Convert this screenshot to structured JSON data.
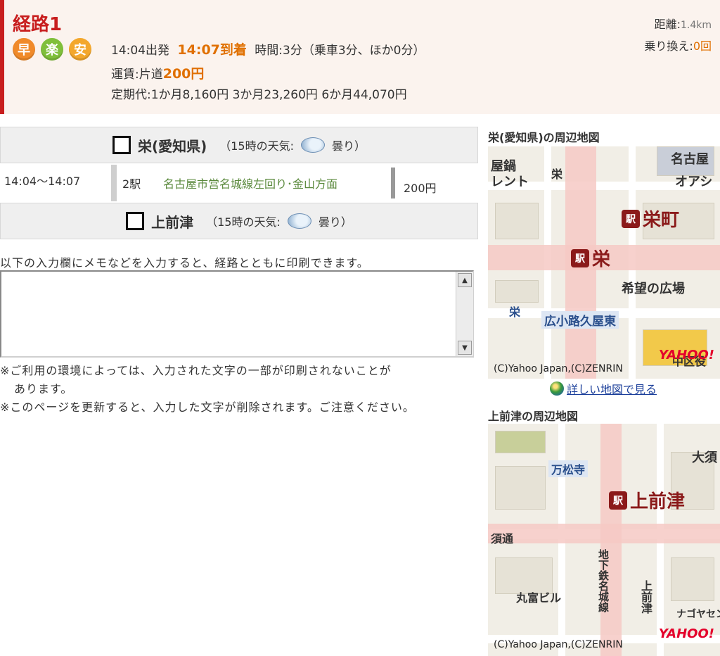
{
  "route": {
    "title": "経路1",
    "badges": [
      "早",
      "楽",
      "安"
    ],
    "depart": "14:04出発",
    "arrive": "14:07到着",
    "duration": "時間:3分（乗車3分、ほか0分）",
    "fare_label": "運賃:片道",
    "fare_value": "200円",
    "commuter": "定期代:1か月8,160円  3か月23,260円  6か月44,070円",
    "distance_label": "距離:",
    "distance_value": "1.4km",
    "transfers_label": "乗り換え:",
    "transfers_value": "0回"
  },
  "from_station": {
    "name": "栄(愛知県)",
    "weather_prefix": "（15時の天気:",
    "weather": "曇り）"
  },
  "segment": {
    "time": "14:04〜14:07",
    "stops": "2駅",
    "line": "名古屋市営名城線左回り･金山方面",
    "fare": "200円"
  },
  "to_station": {
    "name": "上前津",
    "weather_prefix": "（15時の天気:",
    "weather": "曇り）"
  },
  "memo": {
    "label": "以下の入力欄にメモなどを入力すると、経路とともに印刷できます。",
    "value": ""
  },
  "notes": {
    "n1a": "※ご利用の環境によっては、入力された文字の一部が印刷されないことが",
    "n1b": "あります。",
    "n2": "※このページを更新すると、入力した文字が削除されます。ご注意ください。"
  },
  "map1": {
    "title": "栄(愛知県)の周辺地図",
    "labels": [
      "屋鍋",
      "レント",
      "栄",
      "名古屋",
      "オアシ",
      "栄町",
      "希望の広場",
      "広小路久屋東",
      "栄",
      "中区役"
    ],
    "station1": "栄町",
    "station2": "栄",
    "copyright": "(C)Yahoo Japan,(C)ZENRIN",
    "logo": "YAHOO!",
    "link": "詳しい地図で見る"
  },
  "map2": {
    "title": "上前津の周辺地図",
    "labels": [
      "万松寺",
      "大須",
      "須通",
      "丸富ビル",
      "地下鉄名城線",
      "上前津",
      "ナゴヤセンター"
    ],
    "station": "上前津",
    "copyright": "(C)Yahoo Japan,(C)ZENRIN",
    "logo": "YAHOO!"
  }
}
